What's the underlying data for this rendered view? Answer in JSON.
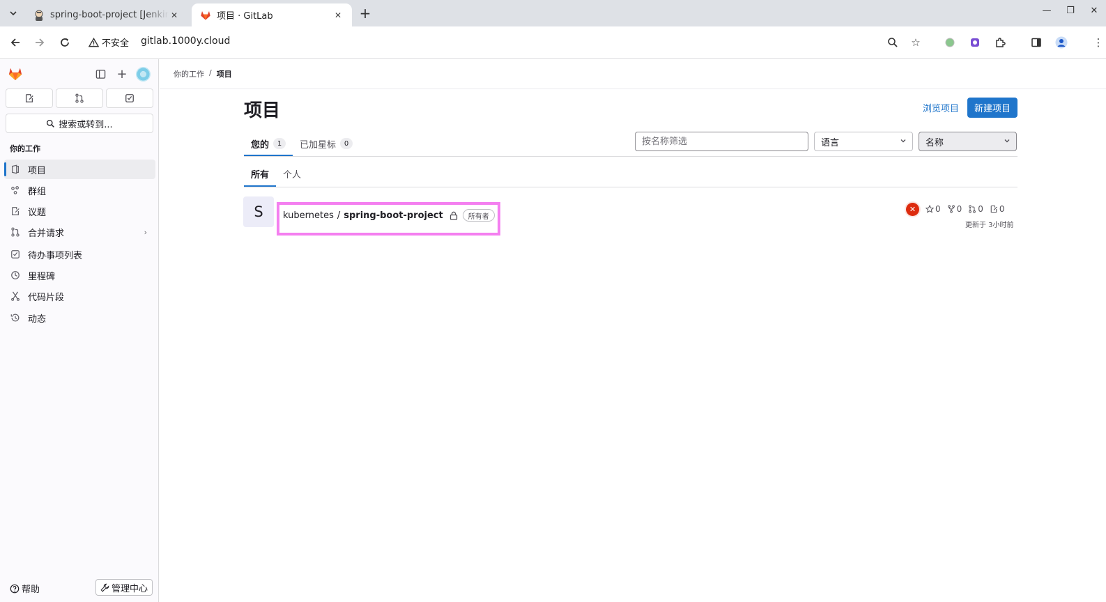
{
  "browser": {
    "tabs": [
      {
        "title": "spring-boot-project [Jenkins]",
        "active": false
      },
      {
        "title": "项目 · GitLab",
        "active": true
      }
    ],
    "security_label": "不安全",
    "url": "gitlab.1000y.cloud"
  },
  "sidebar": {
    "search_label": "搜索或转到...",
    "section_title": "你的工作",
    "items": [
      {
        "label": "项目",
        "icon": "project-icon",
        "active": true
      },
      {
        "label": "群组",
        "icon": "group-icon"
      },
      {
        "label": "议题",
        "icon": "issues-icon"
      },
      {
        "label": "合并请求",
        "icon": "merge-request-icon",
        "has_chevron": true
      },
      {
        "label": "待办事项列表",
        "icon": "todo-icon"
      },
      {
        "label": "里程碑",
        "icon": "milestone-icon"
      },
      {
        "label": "代码片段",
        "icon": "snippet-icon"
      },
      {
        "label": "动态",
        "icon": "activity-icon"
      }
    ],
    "help_label": "帮助",
    "admin_label": "管理中心"
  },
  "breadcrumb": {
    "parent": "你的工作",
    "current": "项目"
  },
  "page": {
    "title": "项目",
    "browse_label": "浏览项目",
    "new_label": "新建项目"
  },
  "tabs": [
    {
      "label": "您的",
      "count": "1",
      "active": true
    },
    {
      "label": "已加星标",
      "count": "0",
      "active": false
    }
  ],
  "filters": {
    "name_placeholder": "按名称筛选",
    "language_label": "语言",
    "sort_label": "名称"
  },
  "subtabs": [
    {
      "label": "所有",
      "active": true
    },
    {
      "label": "个人",
      "active": false
    }
  ],
  "project": {
    "avatar_letter": "S",
    "namespace": "kubernetes",
    "separator": "/",
    "name": "spring-boot-project",
    "role": "所有者",
    "pipeline_status": "failed",
    "stars": "0",
    "forks": "0",
    "merge_requests": "0",
    "issues": "0",
    "updated": "更新于 3小时前"
  },
  "colors": {
    "accent": "#1f75cb",
    "highlight": "#f47ff0",
    "pipeline_failed": "#dd2b0e"
  }
}
